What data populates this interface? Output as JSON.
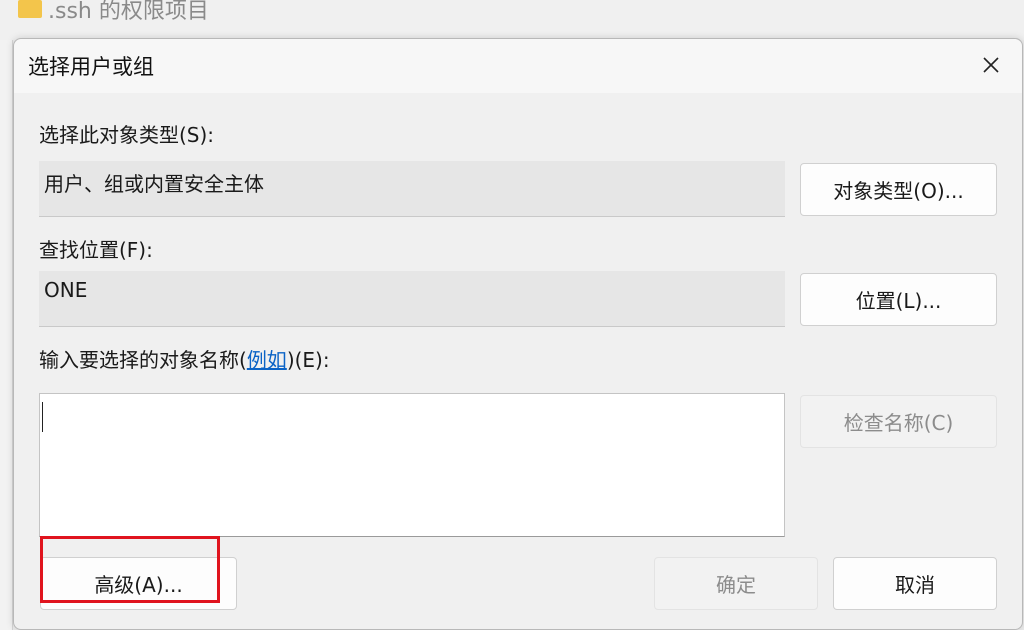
{
  "background_window": {
    "title": ".ssh 的权限项目"
  },
  "dialog": {
    "title": "选择用户或组",
    "object_type": {
      "label": "选择此对象类型(S):",
      "value": "用户、组或内置安全主体",
      "button": "对象类型(O)..."
    },
    "location": {
      "label": "查找位置(F):",
      "value": "ONE",
      "button": "位置(L)..."
    },
    "names": {
      "label_prefix": "输入要选择的对象名称(",
      "label_link": "例如",
      "label_suffix": ")(E):",
      "value": "",
      "check_button": "检查名称(C)"
    },
    "buttons": {
      "advanced": "高级(A)...",
      "ok": "确定",
      "cancel": "取消"
    }
  },
  "colors": {
    "highlight": "#e0141e",
    "link": "#0b63c6"
  }
}
